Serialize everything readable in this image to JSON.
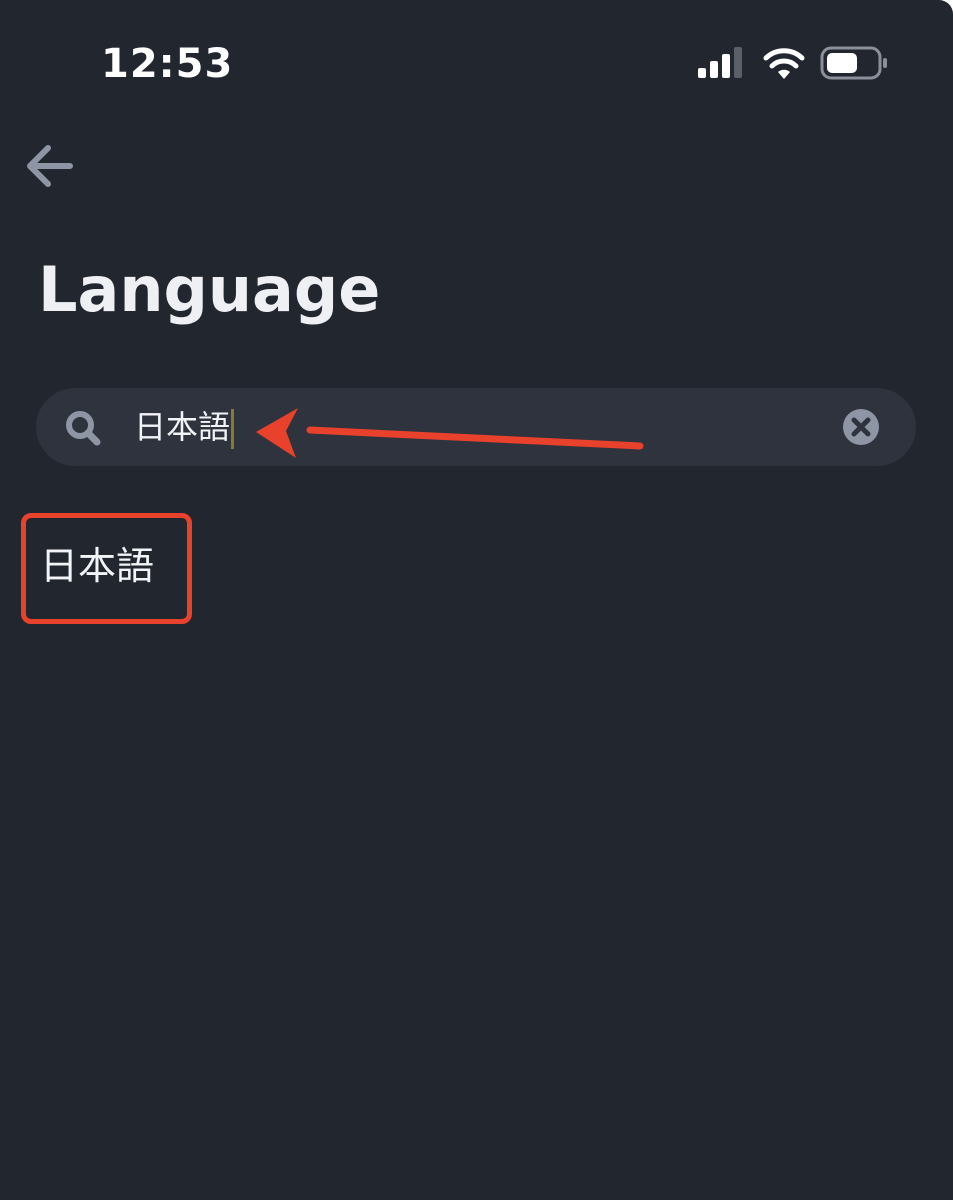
{
  "status_bar": {
    "time": "12:53",
    "icons": [
      "signal-icon",
      "wifi-icon",
      "battery-icon"
    ]
  },
  "nav": {
    "back_icon": "arrow-left-icon"
  },
  "page": {
    "title": "Language"
  },
  "search": {
    "value": "日本語",
    "search_icon": "search-icon",
    "clear_icon": "clear-icon"
  },
  "results": [
    {
      "label": "日本語"
    }
  ],
  "annotations": {
    "arrow_color": "#e8412c",
    "highlight_color": "#e8412c"
  },
  "colors": {
    "background": "#22262f",
    "search_background": "#2e333d",
    "text": "#eef0f4",
    "muted_icon": "#8e96a6"
  }
}
